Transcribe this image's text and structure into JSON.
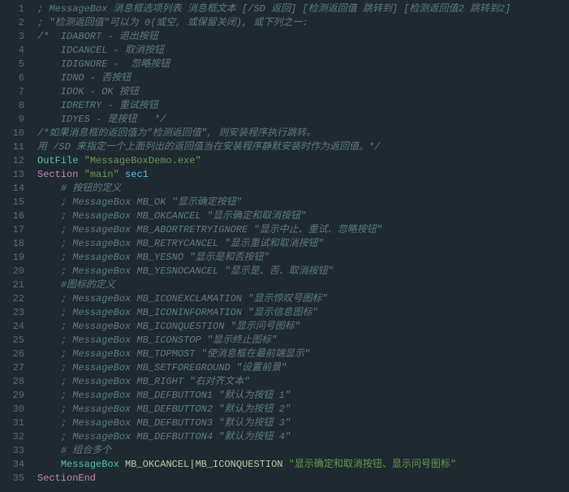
{
  "lines": [
    {
      "n": 1,
      "tokens": [
        {
          "cls": "tok-comment",
          "t": "; MessageBox 消息框选项列表 消息框文本 [/SD 返回] [检测返回值 跳转到] [检测返回值2 跳转到2]"
        }
      ]
    },
    {
      "n": 2,
      "tokens": [
        {
          "cls": "tok-comment",
          "t": "; \"检测返回值\"可以为 0(或空, 或保留关闭), 或下列之一:"
        }
      ]
    },
    {
      "n": 3,
      "tokens": [
        {
          "cls": "tok-comment",
          "t": "/*  IDABORT - 退出按钮"
        }
      ]
    },
    {
      "n": 4,
      "tokens": [
        {
          "cls": "tok-comment",
          "t": "    IDCANCEL - 取消按钮"
        }
      ]
    },
    {
      "n": 5,
      "tokens": [
        {
          "cls": "tok-comment",
          "t": "    IDIGNORE -  忽略按钮"
        }
      ]
    },
    {
      "n": 6,
      "tokens": [
        {
          "cls": "tok-comment",
          "t": "    IDNO - 否按钮"
        }
      ]
    },
    {
      "n": 7,
      "tokens": [
        {
          "cls": "tok-comment",
          "t": "    IDOK - OK 按钮"
        }
      ]
    },
    {
      "n": 8,
      "tokens": [
        {
          "cls": "tok-comment",
          "t": "    IDRETRY - 重试按钮"
        }
      ]
    },
    {
      "n": 9,
      "tokens": [
        {
          "cls": "tok-comment",
          "t": "    IDYES - 是按钮   */"
        }
      ]
    },
    {
      "n": 10,
      "tokens": [
        {
          "cls": "tok-comment",
          "t": "/*如果消息框的返回值为\"检测返回值\", 则安装程序执行跳转。"
        }
      ]
    },
    {
      "n": 11,
      "tokens": [
        {
          "cls": "tok-comment",
          "t": "用 /SD 来指定一个上面列出的返回值当在安装程序静默安装时作为返回值。*/"
        }
      ]
    },
    {
      "n": 12,
      "tokens": [
        {
          "cls": "tok-func",
          "t": "OutFile"
        },
        {
          "cls": "tok-plain",
          "t": " "
        },
        {
          "cls": "tok-string",
          "t": "\"MessageBoxDemo.exe\""
        }
      ]
    },
    {
      "n": 13,
      "tokens": [
        {
          "cls": "tok-keyword",
          "t": "Section"
        },
        {
          "cls": "tok-plain",
          "t": " "
        },
        {
          "cls": "tok-string",
          "t": "\"main\""
        },
        {
          "cls": "tok-plain",
          "t": " "
        },
        {
          "cls": "tok-ident",
          "t": "sec1"
        }
      ]
    },
    {
      "n": 14,
      "tokens": [
        {
          "cls": "tok-plain",
          "t": "    "
        },
        {
          "cls": "tok-comment",
          "t": "# 按钮的定义"
        }
      ]
    },
    {
      "n": 15,
      "tokens": [
        {
          "cls": "tok-plain",
          "t": "    "
        },
        {
          "cls": "tok-comment",
          "t": "; MessageBox MB_OK \"显示确定按钮\""
        }
      ]
    },
    {
      "n": 16,
      "tokens": [
        {
          "cls": "tok-plain",
          "t": "    "
        },
        {
          "cls": "tok-comment",
          "t": "; MessageBox MB_OKCANCEL \"显示确定和取消按钮\""
        }
      ]
    },
    {
      "n": 17,
      "tokens": [
        {
          "cls": "tok-plain",
          "t": "    "
        },
        {
          "cls": "tok-comment",
          "t": "; MessageBox MB_ABORTRETRYIGNORE \"显示中止、重试、忽略按钮\""
        }
      ]
    },
    {
      "n": 18,
      "tokens": [
        {
          "cls": "tok-plain",
          "t": "    "
        },
        {
          "cls": "tok-comment",
          "t": "; MessageBox MB_RETRYCANCEL \"显示重试和取消按钮\""
        }
      ]
    },
    {
      "n": 19,
      "tokens": [
        {
          "cls": "tok-plain",
          "t": "    "
        },
        {
          "cls": "tok-comment",
          "t": "; MessageBox MB_YESNO \"显示是和否按钮\""
        }
      ]
    },
    {
      "n": 20,
      "tokens": [
        {
          "cls": "tok-plain",
          "t": "    "
        },
        {
          "cls": "tok-comment",
          "t": "; MessageBox MB_YESNOCANCEL \"显示是、否、取消按钮\""
        }
      ]
    },
    {
      "n": 21,
      "tokens": [
        {
          "cls": "tok-plain",
          "t": "    "
        },
        {
          "cls": "tok-comment",
          "t": "#图标的定义"
        }
      ]
    },
    {
      "n": 22,
      "tokens": [
        {
          "cls": "tok-plain",
          "t": "    "
        },
        {
          "cls": "tok-comment",
          "t": "; MessageBox MB_ICONEXCLAMATION \"显示惊叹号图标\""
        }
      ]
    },
    {
      "n": 23,
      "tokens": [
        {
          "cls": "tok-plain",
          "t": "    "
        },
        {
          "cls": "tok-comment",
          "t": "; MessageBox MB_ICONINFORMATION \"显示信息图标\""
        }
      ]
    },
    {
      "n": 24,
      "tokens": [
        {
          "cls": "tok-plain",
          "t": "    "
        },
        {
          "cls": "tok-comment",
          "t": "; MessageBox MB_ICONQUESTION \"显示问号图标\""
        }
      ]
    },
    {
      "n": 25,
      "tokens": [
        {
          "cls": "tok-plain",
          "t": "    "
        },
        {
          "cls": "tok-comment",
          "t": "; MessageBox MB_ICONSTOP \"显示终止图标\""
        }
      ]
    },
    {
      "n": 26,
      "tokens": [
        {
          "cls": "tok-plain",
          "t": "    "
        },
        {
          "cls": "tok-comment",
          "t": "; MessageBox MB_TOPMOST \"使消息框在最前端显示\""
        }
      ]
    },
    {
      "n": 27,
      "tokens": [
        {
          "cls": "tok-plain",
          "t": "    "
        },
        {
          "cls": "tok-comment",
          "t": "; MessageBox MB_SETFOREGROUND \"设置前景\""
        }
      ]
    },
    {
      "n": 28,
      "tokens": [
        {
          "cls": "tok-plain",
          "t": "    "
        },
        {
          "cls": "tok-comment",
          "t": "; MessageBox MB_RIGHT \"右对齐文本\""
        }
      ]
    },
    {
      "n": 29,
      "tokens": [
        {
          "cls": "tok-plain",
          "t": "    "
        },
        {
          "cls": "tok-comment",
          "t": "; MessageBox MB_DEFBUTTON1 \"默认为按钮 1\""
        }
      ]
    },
    {
      "n": 30,
      "tokens": [
        {
          "cls": "tok-plain",
          "t": "    "
        },
        {
          "cls": "tok-comment",
          "t": "; MessageBox MB_DEFBUTTON2 \"默认为按钮 2\""
        }
      ]
    },
    {
      "n": 31,
      "tokens": [
        {
          "cls": "tok-plain",
          "t": "    "
        },
        {
          "cls": "tok-comment",
          "t": "; MessageBox MB_DEFBUTTON3 \"默认为按钮 3\""
        }
      ]
    },
    {
      "n": 32,
      "tokens": [
        {
          "cls": "tok-plain",
          "t": "    "
        },
        {
          "cls": "tok-comment",
          "t": "; MessageBox MB_DEFBUTTON4 \"默认为按钮 4\""
        }
      ]
    },
    {
      "n": 33,
      "tokens": [
        {
          "cls": "tok-plain",
          "t": "    "
        },
        {
          "cls": "tok-comment",
          "t": "# 组合多个"
        }
      ]
    },
    {
      "n": 34,
      "tokens": [
        {
          "cls": "tok-plain",
          "t": "    "
        },
        {
          "cls": "tok-func",
          "t": "MessageBox"
        },
        {
          "cls": "tok-plain",
          "t": " "
        },
        {
          "cls": "tok-const",
          "t": "MB_OKCANCEL"
        },
        {
          "cls": "tok-punct",
          "t": "|"
        },
        {
          "cls": "tok-const",
          "t": "MB_ICONQUESTION"
        },
        {
          "cls": "tok-plain",
          "t": " "
        },
        {
          "cls": "tok-string",
          "t": "\"显示确定和取消按钮、显示问号图标\""
        }
      ]
    },
    {
      "n": 35,
      "tokens": [
        {
          "cls": "tok-keyword",
          "t": "SectionEnd"
        }
      ]
    }
  ]
}
